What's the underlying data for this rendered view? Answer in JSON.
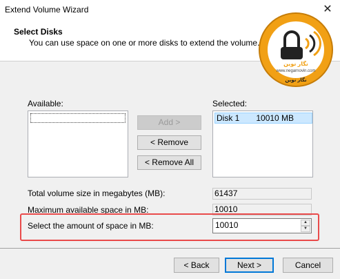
{
  "window": {
    "title": "Extend Volume Wizard",
    "close_glyph": "✕"
  },
  "header": {
    "title": "Select Disks",
    "subtitle": "You can use space on one or more disks to extend the volume."
  },
  "watermark": {
    "brand": "نگار نوین",
    "latin": "www.negarnovin.com",
    "ring_text": "نگار نوین",
    "colors": {
      "ring": "#f1a015",
      "dark": "#222222"
    }
  },
  "available": {
    "label": "Available:",
    "items": []
  },
  "selected": {
    "label": "Selected:",
    "items": [
      {
        "disk": "Disk 1",
        "size": "10010 MB"
      }
    ]
  },
  "buttons": {
    "add": "Add >",
    "remove": "< Remove",
    "remove_all": "< Remove All",
    "back": "< Back",
    "next": "Next >",
    "cancel": "Cancel"
  },
  "fields": {
    "total_label": "Total volume size in megabytes (MB):",
    "total_value": "61437",
    "max_label": "Maximum available space in MB:",
    "max_value": "10010",
    "amount_label": "Select the amount of space in MB:",
    "amount_value": "10010"
  }
}
